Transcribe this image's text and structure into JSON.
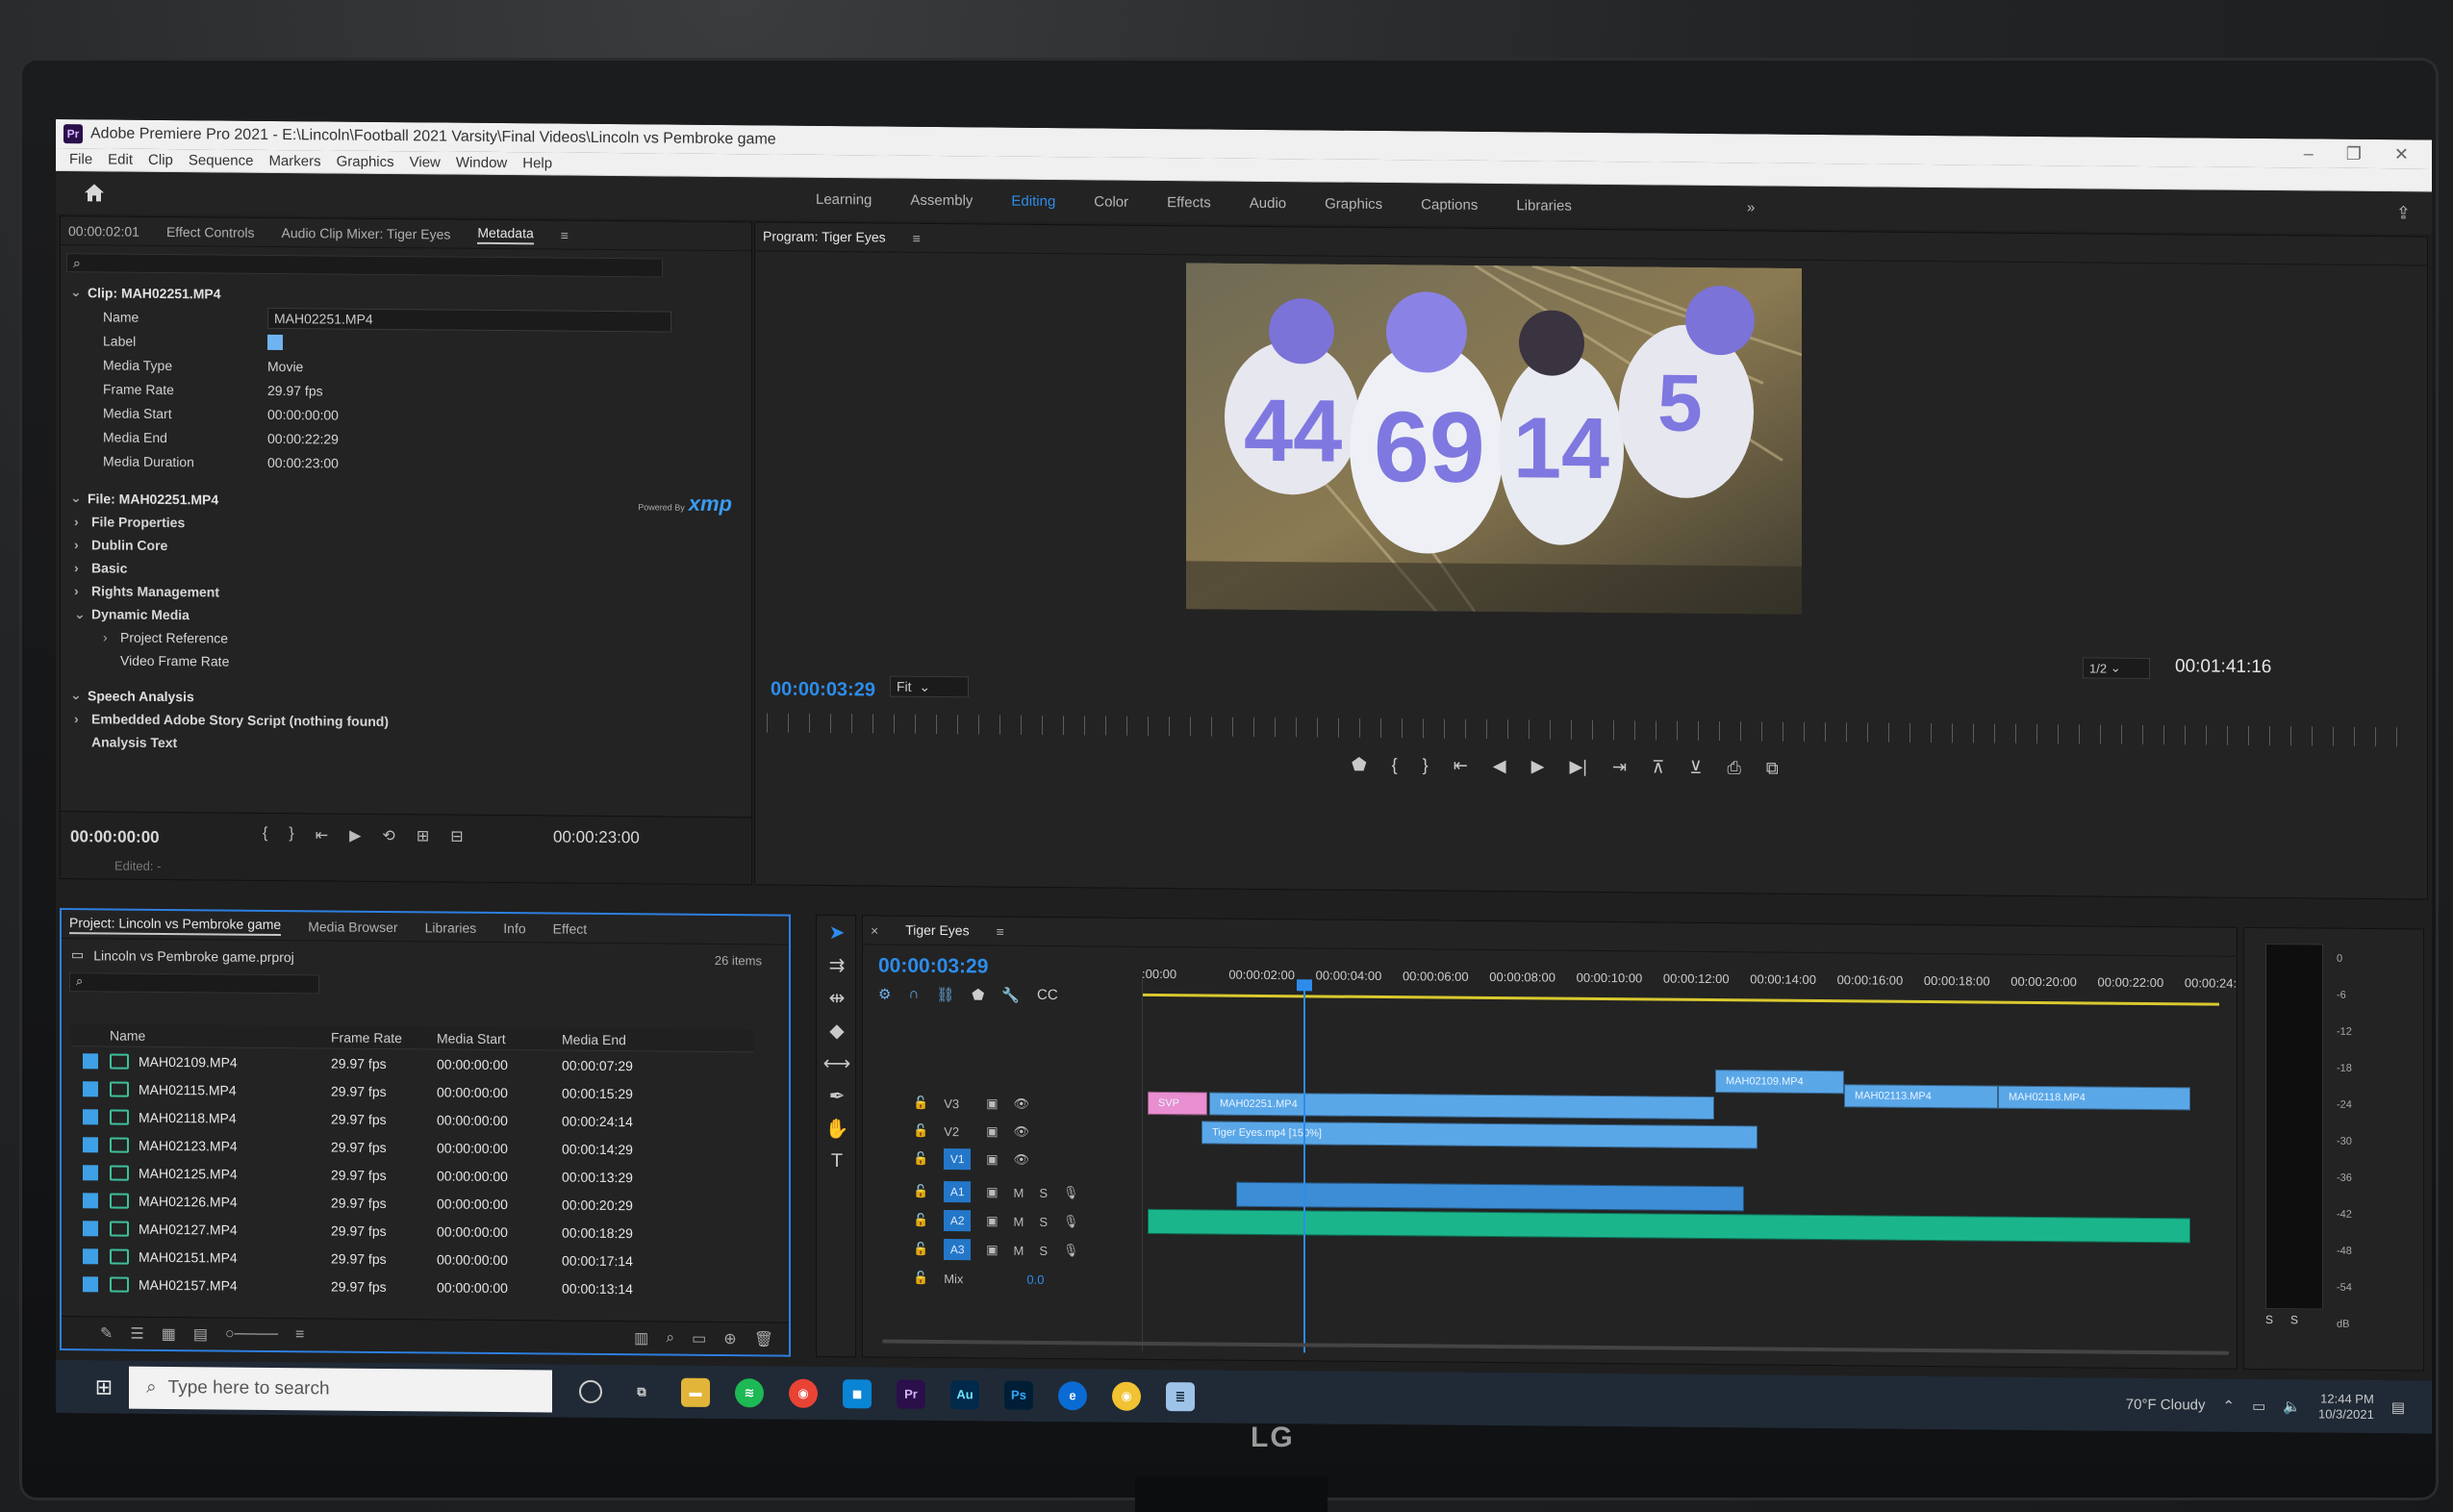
{
  "app": {
    "title": "Adobe Premiere Pro 2021 - E:\\Lincoln\\Football 2021 Varsity\\Final Videos\\Lincoln vs Pembroke game",
    "logo": "Pr",
    "window_controls": [
      "–",
      "❐",
      "✕"
    ]
  },
  "menu": [
    "File",
    "Edit",
    "Clip",
    "Sequence",
    "Markers",
    "Graphics",
    "View",
    "Window",
    "Help"
  ],
  "workspaces": {
    "tabs": [
      "Learning",
      "Assembly",
      "Editing",
      "Color",
      "Effects",
      "Audio",
      "Graphics",
      "Captions",
      "Libraries"
    ],
    "active": "Editing",
    "more": "»",
    "accent": "#2d8ceb"
  },
  "source_panel": {
    "timecode": "00:00:02:01",
    "tabs": [
      "Effect Controls",
      "Audio Clip Mixer: Tiger Eyes",
      "Metadata"
    ],
    "active_tab": "Metadata",
    "clip_header": "Clip: MAH02251.MP4",
    "fields": [
      {
        "key": "Name",
        "value": "MAH02251.MP4"
      },
      {
        "key": "Label",
        "value": ""
      },
      {
        "key": "Media Type",
        "value": "Movie"
      },
      {
        "key": "Frame Rate",
        "value": "29.97 fps"
      },
      {
        "key": "Media Start",
        "value": "00:00:00:00"
      },
      {
        "key": "Media End",
        "value": "00:00:22:29"
      },
      {
        "key": "Media Duration",
        "value": "00:00:23:00"
      }
    ],
    "label_color": "#6fb4f0",
    "file_header": "File: MAH02251.MP4",
    "xmp_powered": "Powered By",
    "xmp_logo": "xmp",
    "file_sections": [
      "File Properties",
      "Dublin Core",
      "Basic",
      "Rights Management",
      "Dynamic Media"
    ],
    "dynamic_media_children": [
      "Project Reference",
      "Video Frame Rate"
    ],
    "speech_header": "Speech Analysis",
    "speech_script": "Embedded Adobe Story Script (nothing found)",
    "analysis_text": "Analysis Text",
    "transport_in": "00:00:00:00",
    "transport_out": "00:00:23:00",
    "edited": "Edited: -"
  },
  "program": {
    "title": "Program: Tiger Eyes",
    "timecode": "00:00:03:29",
    "fit": "Fit",
    "resolution": "1/2",
    "duration": "00:01:41:16"
  },
  "project": {
    "tabs": [
      "Project: Lincoln vs Pembroke game",
      "Media Browser",
      "Libraries",
      "Info",
      "Effect"
    ],
    "file": "Lincoln vs Pembroke game.prproj",
    "count": "26 items",
    "columns": [
      "Name",
      "Frame Rate",
      "Media Start",
      "Media End"
    ],
    "rows": [
      {
        "name": "MAH02109.MP4",
        "fr": "29.97 fps",
        "ms": "00:00:00:00",
        "me": "00:00:07:29"
      },
      {
        "name": "MAH02115.MP4",
        "fr": "29.97 fps",
        "ms": "00:00:00:00",
        "me": "00:00:15:29"
      },
      {
        "name": "MAH02118.MP4",
        "fr": "29.97 fps",
        "ms": "00:00:00:00",
        "me": "00:00:24:14"
      },
      {
        "name": "MAH02123.MP4",
        "fr": "29.97 fps",
        "ms": "00:00:00:00",
        "me": "00:00:14:29"
      },
      {
        "name": "MAH02125.MP4",
        "fr": "29.97 fps",
        "ms": "00:00:00:00",
        "me": "00:00:13:29"
      },
      {
        "name": "MAH02126.MP4",
        "fr": "29.97 fps",
        "ms": "00:00:00:00",
        "me": "00:00:20:29"
      },
      {
        "name": "MAH02127.MP4",
        "fr": "29.97 fps",
        "ms": "00:00:00:00",
        "me": "00:00:18:29"
      },
      {
        "name": "MAH02151.MP4",
        "fr": "29.97 fps",
        "ms": "00:00:00:00",
        "me": "00:00:17:14"
      },
      {
        "name": "MAH02157.MP4",
        "fr": "29.97 fps",
        "ms": "00:00:00:00",
        "me": "00:00:13:14"
      }
    ],
    "row_color": "#3ea0e6"
  },
  "timeline": {
    "title": "Tiger Eyes",
    "timecode": "00:00:03:29",
    "ruler": [
      ":00:00",
      "00:00:02:00",
      "00:00:04:00",
      "00:00:06:00",
      "00:00:08:00",
      "00:00:10:00",
      "00:00:12:00",
      "00:00:14:00",
      "00:00:16:00",
      "00:00:18:00",
      "00:00:20:00",
      "00:00:22:00",
      "00:00:24:00"
    ],
    "tracks": [
      "V3",
      "V2",
      "V1",
      "A1",
      "A2",
      "A3"
    ],
    "mix_label": "Mix",
    "mix_value": "0.0",
    "clips": {
      "v3_a": "MAH02109.MP4",
      "v2_a": "MAH02251.MP4",
      "v2_pink": "SVP",
      "v2_b": "MAH02113.MP4",
      "v2_c": "MAH02118.MP4",
      "v1_a": "Tiger Eyes.mp4 [150%]"
    }
  },
  "meter": {
    "scale": [
      "0",
      "-6",
      "-12",
      "-18",
      "-24",
      "-30",
      "-36",
      "-42",
      "-48",
      "-54",
      "dB"
    ],
    "solo": [
      "S",
      "S"
    ]
  },
  "taskbar": {
    "search_placeholder": "Type here to search",
    "weather": "70°F Cloudy",
    "time": "12:44 PM",
    "date": "10/3/2021",
    "apps": [
      "Spotify",
      "Chrome",
      "Store",
      "Pr",
      "Au",
      "Ps",
      "Edge",
      "Chrome2",
      "Notepad"
    ]
  },
  "monitor_brand": "LG"
}
